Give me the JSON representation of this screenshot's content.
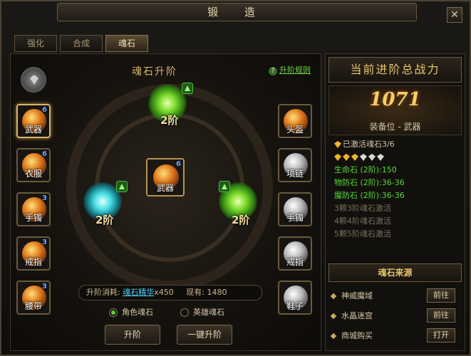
{
  "window": {
    "title": "锻 造",
    "close": "✕"
  },
  "tabs": [
    {
      "label": "强化"
    },
    {
      "label": "合成"
    },
    {
      "label": "魂石"
    }
  ],
  "panel": {
    "title": "魂石升阶",
    "help": "升阶规则",
    "help_icon": "?"
  },
  "left_slots": [
    {
      "label": "武器",
      "level": "6"
    },
    {
      "label": "衣服",
      "level": "6"
    },
    {
      "label": "手镯",
      "level": "3"
    },
    {
      "label": "戒指",
      "level": "3"
    },
    {
      "label": "腰带",
      "level": "3"
    }
  ],
  "right_slots": [
    {
      "label": "头盔"
    },
    {
      "label": "项链"
    },
    {
      "label": "手镯"
    },
    {
      "label": "戒指"
    },
    {
      "label": "鞋子"
    }
  ],
  "center": {
    "label": "武器",
    "level": "6"
  },
  "souls": [
    {
      "level": "2阶"
    },
    {
      "level": "2阶"
    },
    {
      "level": "2阶"
    }
  ],
  "cost": {
    "label": "升阶消耗:",
    "item": "魂石精华",
    "amount": "x450",
    "have_label": "现有:",
    "have": "1480"
  },
  "radios": [
    {
      "label": "角色魂石"
    },
    {
      "label": "英雄魂石"
    }
  ],
  "buttons": {
    "upgrade": "升阶",
    "one_click": "一键升阶"
  },
  "right": {
    "header": "当前进阶总战力",
    "power": "1071",
    "equip_pos": "装备位 - 武器",
    "active": "已激活魂石3/6",
    "stars": {
      "gold": 3,
      "total": 6
    },
    "stats": [
      {
        "text": "生命石 (2阶):150"
      },
      {
        "text": "物防石 (2阶):36-36"
      },
      {
        "text": "魔防石 (2阶):36-36"
      }
    ],
    "inactive": [
      {
        "text": "3颗3阶魂石激活"
      },
      {
        "text": "4颗4阶魂石激活"
      },
      {
        "text": "5颗5阶魂石激活"
      }
    ],
    "source_header": "魂石来源",
    "sources": [
      {
        "name": "神威魔域",
        "btn": "前往"
      },
      {
        "name": "水晶迷宫",
        "btn": "前往"
      },
      {
        "name": "商城购买",
        "btn": "打开"
      }
    ]
  },
  "colors": {
    "accent": "#e8c46a",
    "green": "#58d83a",
    "cyan": "#4fd2ff"
  }
}
